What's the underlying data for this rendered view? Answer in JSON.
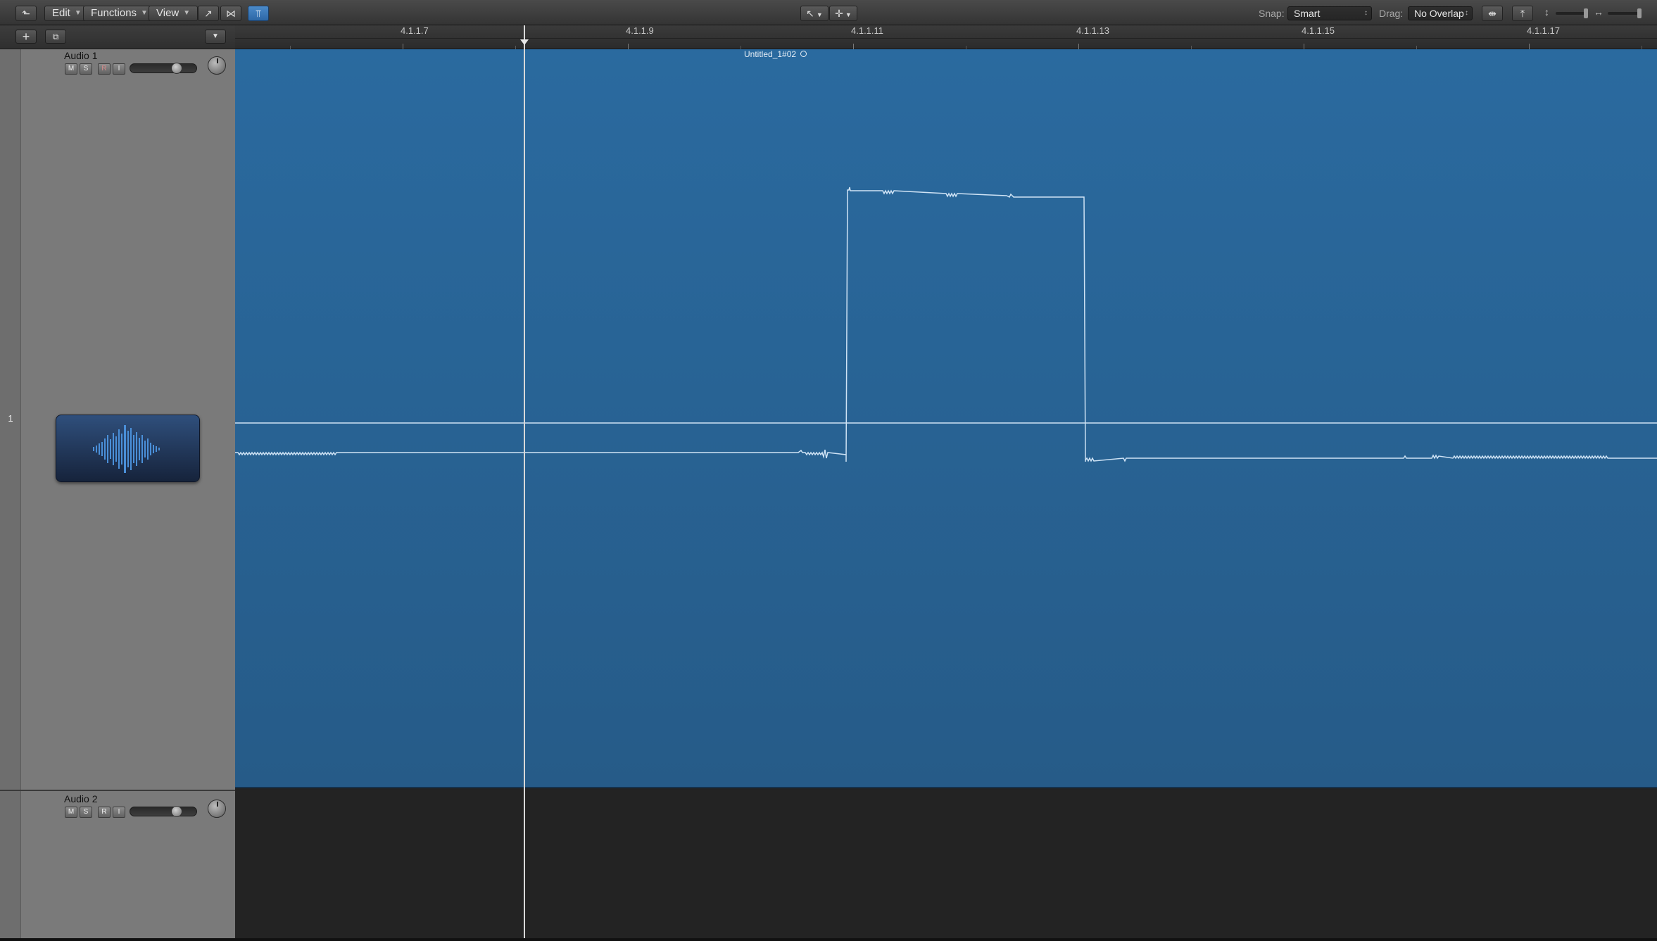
{
  "toolbar": {
    "edit_label": "Edit",
    "functions_label": "Functions",
    "view_label": "View",
    "snap_label": "Snap:",
    "snap_value": "Smart",
    "drag_label": "Drag:",
    "drag_value": "No Overlap"
  },
  "ruler": {
    "labels": [
      "4.1.1.7",
      "4.1.1.9",
      "4.1.1.11",
      "4.1.1.13",
      "4.1.1.15",
      "4.1.1.17"
    ]
  },
  "tracks": [
    {
      "number": "1",
      "name": "Audio 1",
      "buttons": [
        "M",
        "S",
        "R",
        "I"
      ],
      "volume_level": 0.7
    },
    {
      "number": "",
      "name": "Audio 2",
      "buttons": [
        "M",
        "S",
        "R",
        "I"
      ],
      "volume_level": 0.7
    }
  ],
  "region": {
    "name": "Untitled_1#02",
    "color": "#2a6a9f"
  },
  "colors": {
    "accent": "#2d67a6",
    "region": "#2a6a9f",
    "track_header": "#7a7a7a",
    "waveform": "#cfe3f5"
  },
  "icons": {
    "back": "arrow-up-left-icon",
    "automation": "curve-icon",
    "flex": "flex-icon",
    "filter": "filter-icon",
    "pointer_tool": "pointer-tool-icon",
    "crosshair_tool": "crosshair-tool-icon",
    "add_track": "plus-icon",
    "track_options": "track-options-icon",
    "dropdown": "chevron-down-icon"
  }
}
